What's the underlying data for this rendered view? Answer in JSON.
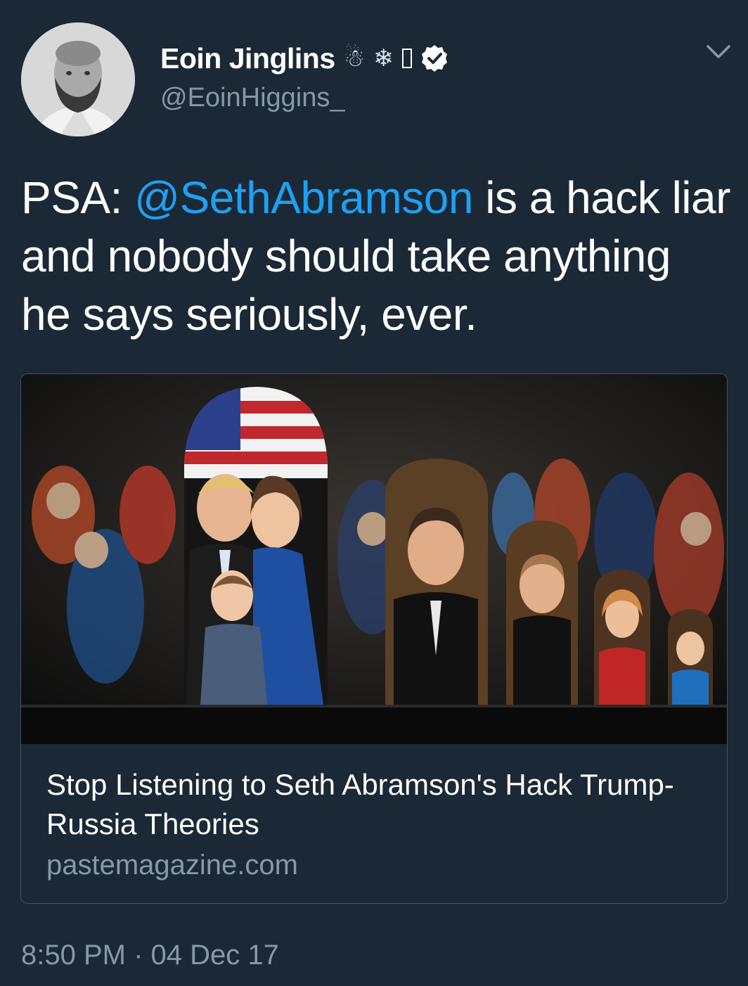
{
  "tweet": {
    "display_name": "Eoin Jinglins",
    "name_emoji": [
      "☃",
      "❄"
    ],
    "handle": "@EoinHiggins_",
    "verified": true,
    "text_prefix": "PSA: ",
    "mention": "@SethAbramson",
    "text_suffix": " is a hack liar and nobody should take anything he says seriously, ever.",
    "time": "8:50 PM",
    "separator": "·",
    "date": "04 Dec 17"
  },
  "card": {
    "title": "Stop Listening to Seth Abramson's Hack Trump-Russia Theories",
    "domain": "pastemagazine.com"
  },
  "colors": {
    "background": "#1b2836",
    "link": "#1da1f2",
    "secondary_text": "#8899a6",
    "card_border": "#3d5466"
  }
}
